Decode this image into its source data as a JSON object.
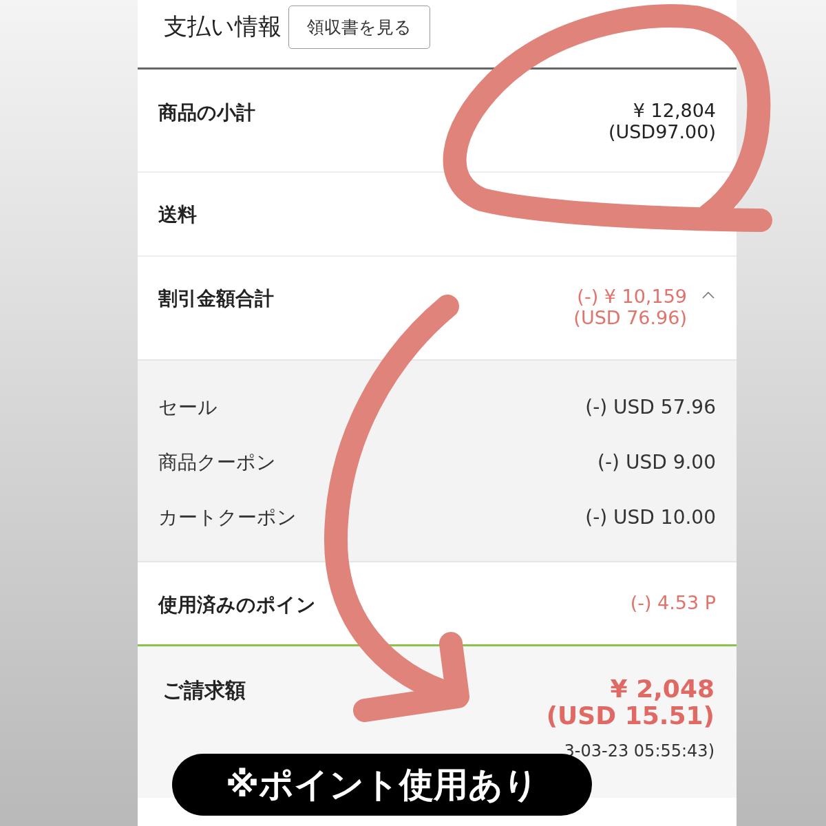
{
  "header": {
    "title": "支払い情報",
    "receipt_button": "領収書を見る"
  },
  "subtotal": {
    "label": "商品の小計",
    "value": "¥ 12,804",
    "sub_value": "(USD97.00)"
  },
  "shipping": {
    "label": "送料"
  },
  "discount": {
    "label": "割引金額合計",
    "value": "(-) ¥ 10,159",
    "sub_value": "(USD 76.96)",
    "expanded": true,
    "items": [
      {
        "label": "セール",
        "value": "(-) USD 57.96"
      },
      {
        "label": "商品クーポン",
        "value": "(-) USD 9.00"
      },
      {
        "label": "カートクーポン",
        "value": "(-) USD 10.00"
      }
    ]
  },
  "points": {
    "label": "使用済みのポイン",
    "value": "(-) 4.53 P"
  },
  "total": {
    "label": "ご請求額",
    "value": "¥ 2,048",
    "sub_value": "(USD 15.51)",
    "payment": "3-03-23 05:55:43)"
  },
  "annotation": {
    "note": "※ポイント使用あり"
  }
}
